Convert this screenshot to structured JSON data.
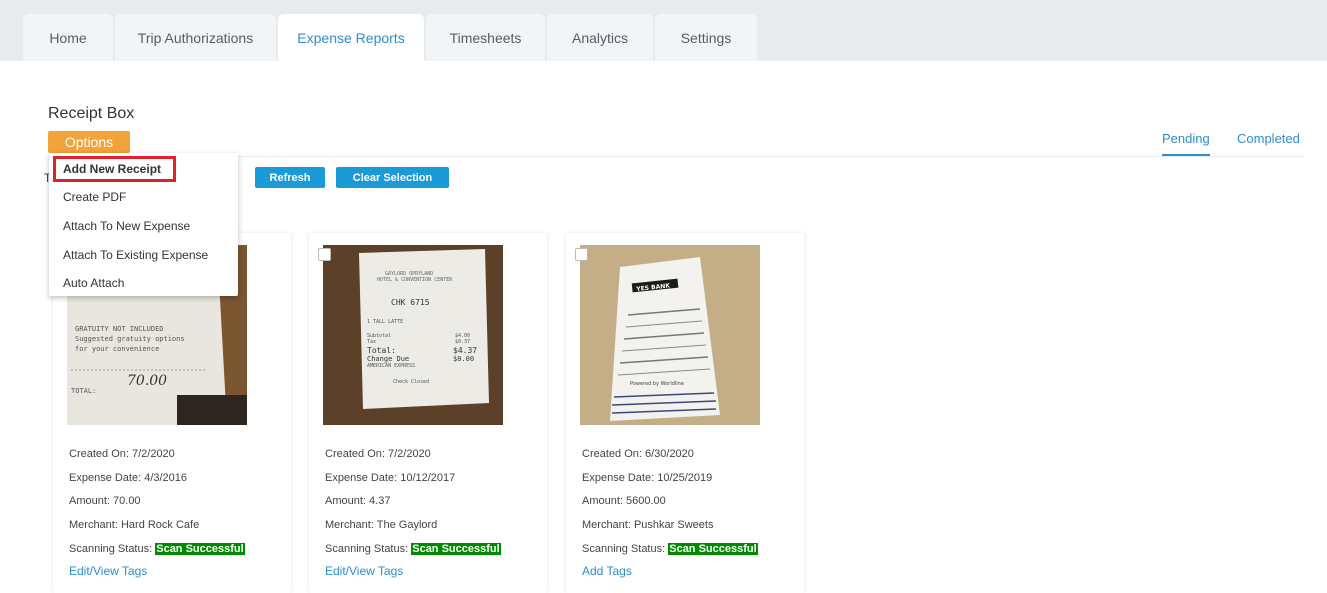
{
  "nav": {
    "tabs": [
      {
        "label": "Home"
      },
      {
        "label": "Trip Authorizations"
      },
      {
        "label": "Expense Reports",
        "active": true
      },
      {
        "label": "Timesheets"
      },
      {
        "label": "Analytics"
      },
      {
        "label": "Settings"
      }
    ]
  },
  "page": {
    "title": "Receipt Box",
    "options_label": "Options"
  },
  "filters": {
    "pending": "Pending",
    "completed": "Completed",
    "active": "Pending"
  },
  "toolbar": {
    "partial_label": "T",
    "refresh_label": "Refresh",
    "clear_selection_label": "Clear Selection"
  },
  "menu": {
    "items": [
      {
        "label": "Add New Receipt"
      },
      {
        "label": "Create PDF"
      },
      {
        "label": "Attach To New Expense"
      },
      {
        "label": "Attach To Existing Expense"
      },
      {
        "label": "Auto Attach"
      }
    ]
  },
  "receipts": [
    {
      "created_on": "Created On: 7/2/2020",
      "expense_date": "Expense Date: 4/3/2016",
      "amount": "Amount: 70.00",
      "merchant": "Merchant: Hard Rock Cafe",
      "scanning_label": "Scanning Status:",
      "scanning_status": "Scan Successful",
      "tags_link": "Edit/View Tags"
    },
    {
      "created_on": "Created On: 7/2/2020",
      "expense_date": "Expense Date: 10/12/2017",
      "amount": "Amount: 4.37",
      "merchant": "Merchant: The Gaylord",
      "scanning_label": "Scanning Status:",
      "scanning_status": "Scan Successful",
      "tags_link": "Edit/View Tags"
    },
    {
      "created_on": "Created On: 6/30/2020",
      "expense_date": "Expense Date: 10/25/2019",
      "amount": "Amount: 5600.00",
      "merchant": "Merchant: Pushkar Sweets",
      "scanning_label": "Scanning Status:",
      "scanning_status": "Scan Successful",
      "tags_link": "Add Tags"
    }
  ],
  "receipt_images": [
    {
      "lines": [
        "GRATUITY NOT INCLUDED",
        "Suggested gratuity options",
        "for your convenience",
        "TOTAL:",
        "70.00"
      ]
    },
    {
      "lines": [
        "GAYLORD OPRYLAND",
        "HOTEL & CONVENTION CENTER",
        "CHK 6715",
        "1 TALL LATTE",
        "Subtotal",
        "$4.00",
        "Tax",
        "$0.37",
        "Total:",
        "$4.37",
        "Change Due",
        "$0.00",
        "AMERICAN EXPRESS",
        "Check Closed"
      ]
    },
    {
      "lines": [
        "YES BANK",
        "Powered by Worldline"
      ]
    }
  ],
  "colors": {
    "accent": "#2e8ec9",
    "options": "#f4a23a",
    "button": "#1a9ad6",
    "status": "#008a00",
    "highlight": "#e0202a"
  }
}
